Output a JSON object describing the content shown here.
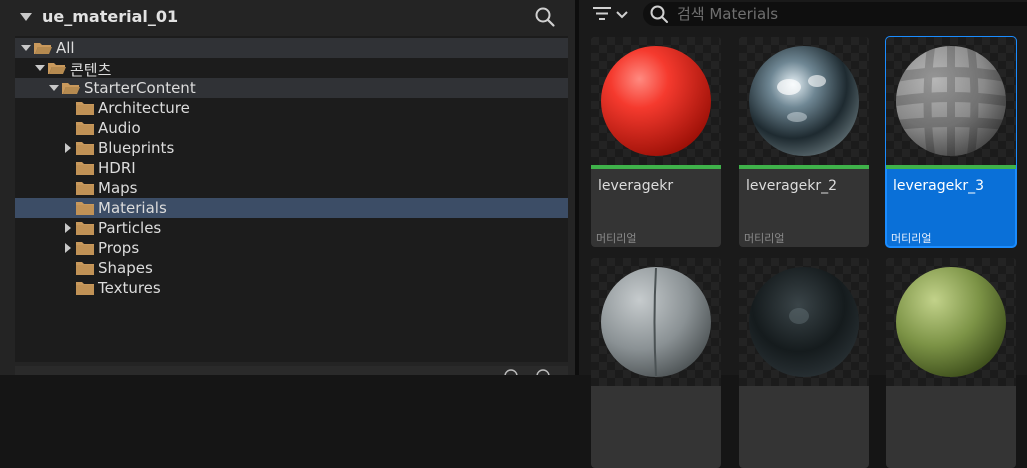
{
  "sources_panel": {
    "title": "ue_material_01",
    "tree": [
      {
        "label": "All",
        "depth": 0,
        "expandable": true,
        "expanded": true,
        "state": "highlight"
      },
      {
        "label": "콘텐츠",
        "depth": 1,
        "expandable": true,
        "expanded": true,
        "state": ""
      },
      {
        "label": "StarterContent",
        "depth": 2,
        "expandable": true,
        "expanded": true,
        "state": "highlight"
      },
      {
        "label": "Architecture",
        "depth": 3,
        "expandable": false,
        "expanded": false,
        "state": ""
      },
      {
        "label": "Audio",
        "depth": 3,
        "expandable": false,
        "expanded": false,
        "state": ""
      },
      {
        "label": "Blueprints",
        "depth": 3,
        "expandable": true,
        "expanded": false,
        "state": ""
      },
      {
        "label": "HDRI",
        "depth": 3,
        "expandable": false,
        "expanded": false,
        "state": ""
      },
      {
        "label": "Maps",
        "depth": 3,
        "expandable": false,
        "expanded": false,
        "state": ""
      },
      {
        "label": "Materials",
        "depth": 3,
        "expandable": false,
        "expanded": false,
        "state": "selected"
      },
      {
        "label": "Particles",
        "depth": 3,
        "expandable": true,
        "expanded": false,
        "state": ""
      },
      {
        "label": "Props",
        "depth": 3,
        "expandable": true,
        "expanded": false,
        "state": ""
      },
      {
        "label": "Shapes",
        "depth": 3,
        "expandable": false,
        "expanded": false,
        "state": ""
      },
      {
        "label": "Textures",
        "depth": 3,
        "expandable": false,
        "expanded": false,
        "state": ""
      }
    ]
  },
  "assets_panel": {
    "search_placeholder": "검색 Materials",
    "search_value": "",
    "assets": [
      {
        "name": "leveragekr",
        "type": "머티리얼",
        "material": "red",
        "selected": false,
        "row": 0,
        "col": 0
      },
      {
        "name": "leveragekr_2",
        "type": "머티리얼",
        "material": "chrome",
        "selected": false,
        "row": 0,
        "col": 1
      },
      {
        "name": "leveragekr_3",
        "type": "머티리얼",
        "material": "checker",
        "selected": true,
        "row": 0,
        "col": 2
      },
      {
        "name": "",
        "type": "",
        "material": "concrete",
        "selected": false,
        "row": 1,
        "col": 0
      },
      {
        "name": "",
        "type": "",
        "material": "dark",
        "selected": false,
        "row": 1,
        "col": 1
      },
      {
        "name": "",
        "type": "",
        "material": "grass",
        "selected": false,
        "row": 1,
        "col": 2
      }
    ]
  },
  "colors": {
    "selection": "#0a70d8",
    "tree_selected": "#3c4d66",
    "tree_highlight": "#303236",
    "asset_bar": "#3fb24a",
    "folder": "#c9995c"
  },
  "icons": [
    "collapse-caret-icon",
    "search-icon",
    "folder-icon",
    "folder-open-icon",
    "expand-arrow-icon",
    "filter-icon",
    "chevron-down-icon"
  ]
}
